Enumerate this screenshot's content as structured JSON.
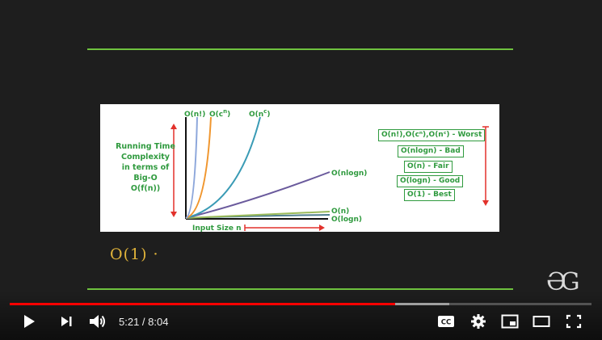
{
  "slide": {
    "ylabel_lines": [
      "Running Time",
      "Complexity",
      "in terms of",
      "Big-O",
      "O(f(n))"
    ],
    "xlabel": "Input Size n",
    "curve_labels": {
      "factorial": "O(n!)",
      "exponential": "O(c",
      "exponential_sup": "n",
      "exponential_close": ")",
      "polynomial": "O(n",
      "polynomial_sup": "c",
      "polynomial_close": ")",
      "nlogn": "O(nlogn)",
      "n": "O(n)",
      "logn": "O(logn)"
    },
    "legend": [
      "O(n!),O(cⁿ),O(nᶜ) - Worst",
      "O(nlogn) - Bad",
      "O(n) - Fair",
      "O(logn) - Good",
      "O(1) - Best"
    ],
    "colors": {
      "green_label": "#2f9a3e",
      "red_arrow": "#e2312b",
      "factorial": "#8da7db",
      "exponential": "#f0962e",
      "polynomial": "#3a9bb5",
      "nlogn": "#6a5a9c",
      "n": "#9bbb59",
      "logn": "#4f7f8f"
    }
  },
  "handwriting": "O(1) ·",
  "logo": "ƏG",
  "player": {
    "current_time": "5:21",
    "separator": " / ",
    "duration": "8:04",
    "played_fraction": 0.662,
    "buffered_fraction": 0.755,
    "icons": {
      "play": "play-icon",
      "next": "next-icon",
      "volume": "volume-icon",
      "captions": "cc-icon",
      "settings": "gear-icon",
      "miniplayer": "miniplayer-icon",
      "theater": "theater-icon",
      "fullscreen": "fullscreen-icon"
    },
    "accent": "#ff0000"
  }
}
